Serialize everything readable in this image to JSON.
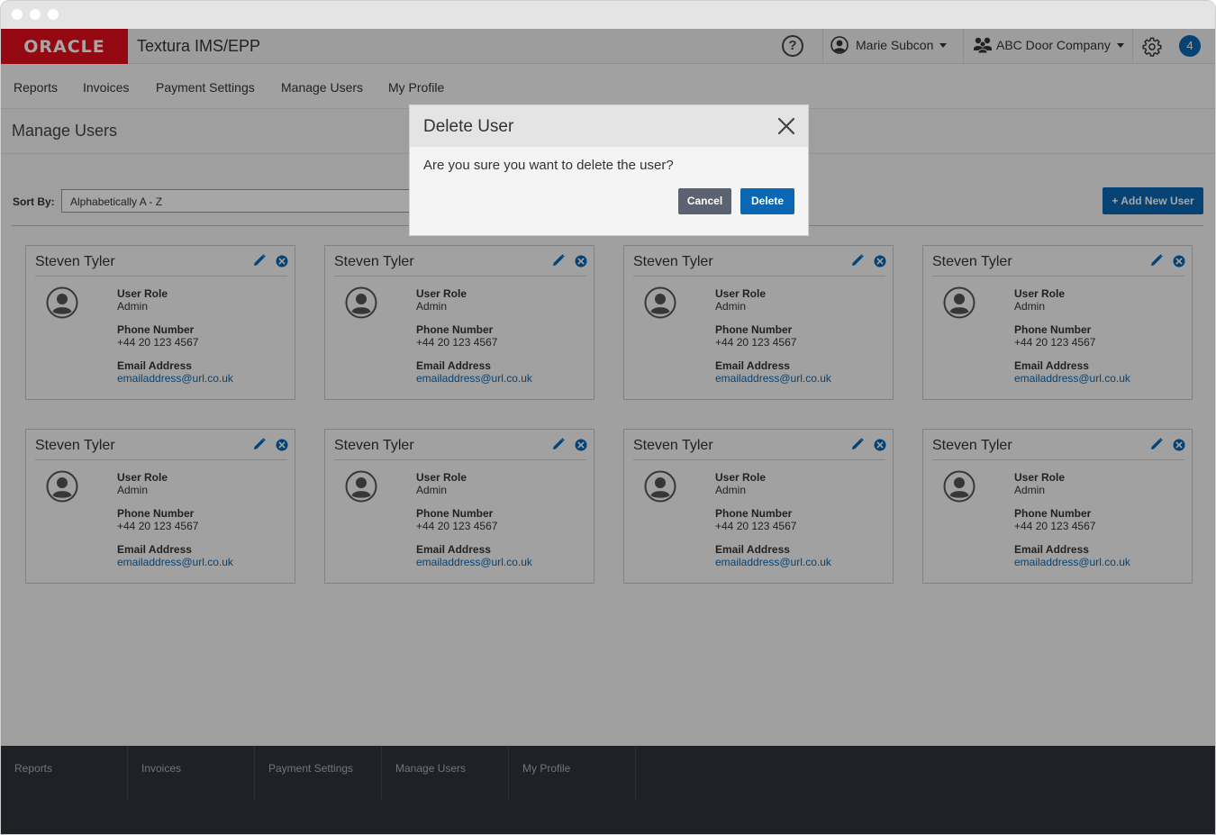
{
  "header": {
    "logo_text": "ORACLE",
    "app_title": "Textura IMS/EPP",
    "help_label": "?",
    "user_name": "Marie Subcon",
    "company_name": "ABC Door Company",
    "notification_count": "4"
  },
  "nav": {
    "items": [
      "Reports",
      "Invoices",
      "Payment Settings",
      "Manage Users",
      "My Profile"
    ]
  },
  "page": {
    "title": "Manage Users",
    "sort_label": "Sort By:",
    "sort_value": "Alphabetically A - Z",
    "add_user_label": "+ Add New User"
  },
  "labels": {
    "role": "User Role",
    "phone": "Phone Number",
    "email": "Email Address"
  },
  "cards": [
    {
      "name": "Steven Tyler",
      "role": "Admin",
      "phone": "+44 20 123 4567",
      "email": "emailaddress@url.co.uk"
    },
    {
      "name": "Steven Tyler",
      "role": "Admin",
      "phone": "+44 20 123 4567",
      "email": "emailaddress@url.co.uk"
    },
    {
      "name": "Steven Tyler",
      "role": "Admin",
      "phone": "+44 20 123 4567",
      "email": "emailaddress@url.co.uk"
    },
    {
      "name": "Steven Tyler",
      "role": "Admin",
      "phone": "+44 20 123 4567",
      "email": "emailaddress@url.co.uk"
    },
    {
      "name": "Steven Tyler",
      "role": "Admin",
      "phone": "+44 20 123 4567",
      "email": "emailaddress@url.co.uk"
    },
    {
      "name": "Steven Tyler",
      "role": "Admin",
      "phone": "+44 20 123 4567",
      "email": "emailaddress@url.co.uk"
    },
    {
      "name": "Steven Tyler",
      "role": "Admin",
      "phone": "+44 20 123 4567",
      "email": "emailaddress@url.co.uk"
    },
    {
      "name": "Steven Tyler",
      "role": "Admin",
      "phone": "+44 20 123 4567",
      "email": "emailaddress@url.co.uk"
    }
  ],
  "footer": {
    "items": [
      "Reports",
      "Invoices",
      "Payment Settings",
      "Manage Users",
      "My Profile"
    ]
  },
  "modal": {
    "title": "Delete User",
    "message": "Are you sure you want to delete the user?",
    "cancel_label": "Cancel",
    "delete_label": "Delete"
  },
  "icons": {
    "help": "help-icon",
    "user": "user-circle-icon",
    "company": "group-icon",
    "settings": "gear-icon",
    "edit": "pencil-icon",
    "remove": "close-circle-icon",
    "avatar": "avatar-icon",
    "close": "close-icon"
  },
  "colors": {
    "brand_red": "#e30f1b",
    "primary_blue": "#0a67b3",
    "footer_bg": "#2f343b",
    "cancel_gray": "#5b6370"
  }
}
